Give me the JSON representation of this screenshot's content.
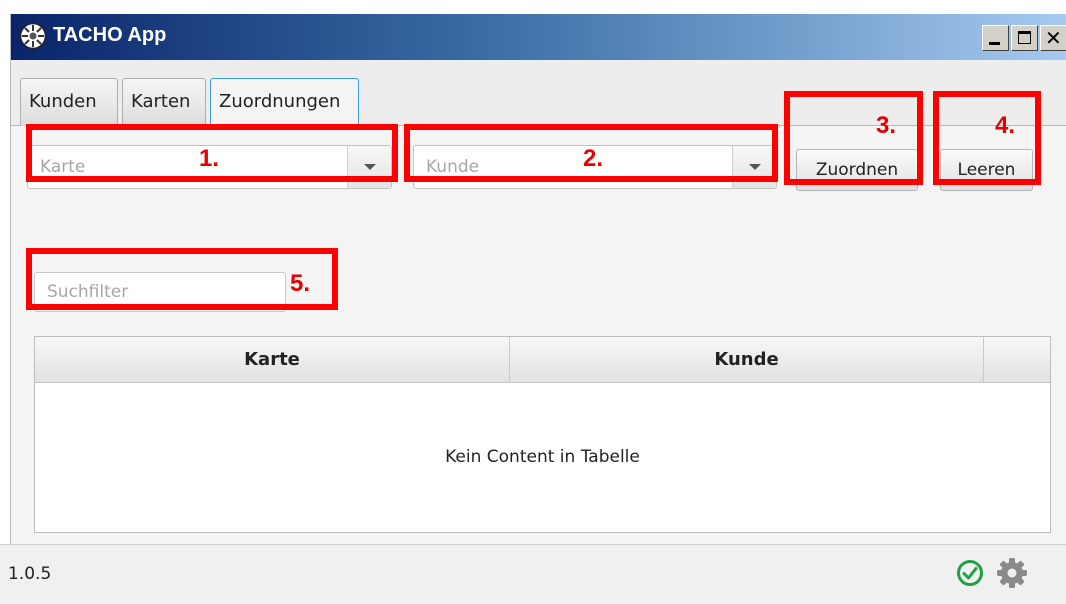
{
  "window": {
    "title": "TACHO App"
  },
  "tabs": [
    {
      "label": "Kunden",
      "active": false
    },
    {
      "label": "Karten",
      "active": false
    },
    {
      "label": "Zuordnungen",
      "active": true
    }
  ],
  "form": {
    "karte_placeholder": "Karte",
    "kunde_placeholder": "Kunde",
    "assign_label": "Zuordnen",
    "clear_label": "Leeren",
    "search_placeholder": "Suchfilter"
  },
  "table": {
    "columns": [
      "Karte",
      "Kunde",
      ""
    ],
    "rows": [],
    "empty_message": "Kein Content in Tabelle"
  },
  "statusbar": {
    "version": "1.0.5",
    "status_icon": "check-circle-icon",
    "settings_icon": "gear-icon"
  },
  "annotations": [
    "1.",
    "2.",
    "3.",
    "4.",
    "5."
  ],
  "colors": {
    "annotation": "#ff0000",
    "tab_active_border": "#3c9be0",
    "status_ok": "#22a045"
  }
}
